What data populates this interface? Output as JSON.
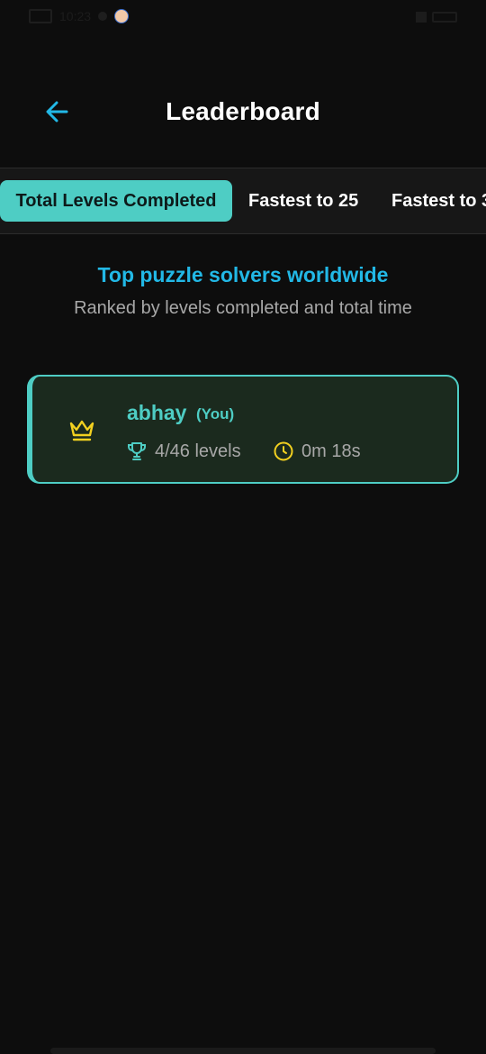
{
  "status_bar": {
    "time": "10:23"
  },
  "header": {
    "title": "Leaderboard",
    "back_icon": "arrow-left-icon"
  },
  "tabs": [
    {
      "label": "Total Levels Completed",
      "active": true
    },
    {
      "label": "Fastest to 25",
      "active": false
    },
    {
      "label": "Fastest to 3",
      "active": false
    }
  ],
  "intro": {
    "title": "Top puzzle solvers worldwide",
    "subtitle": "Ranked by levels completed and total time"
  },
  "entries": [
    {
      "name": "abhay",
      "badge": "(You)",
      "rank_icon": "crown-icon",
      "levels": "4/46 levels",
      "levels_icon": "trophy-icon",
      "time": "0m 18s",
      "time_icon": "clock-icon"
    }
  ],
  "colors": {
    "background": "#0d0d0d",
    "accent": "#4ecdc4",
    "subtitle": "#22b8e6",
    "card": "#1b2a1e",
    "gold": "#f2d020",
    "muted_text": "#a8a8a8"
  }
}
